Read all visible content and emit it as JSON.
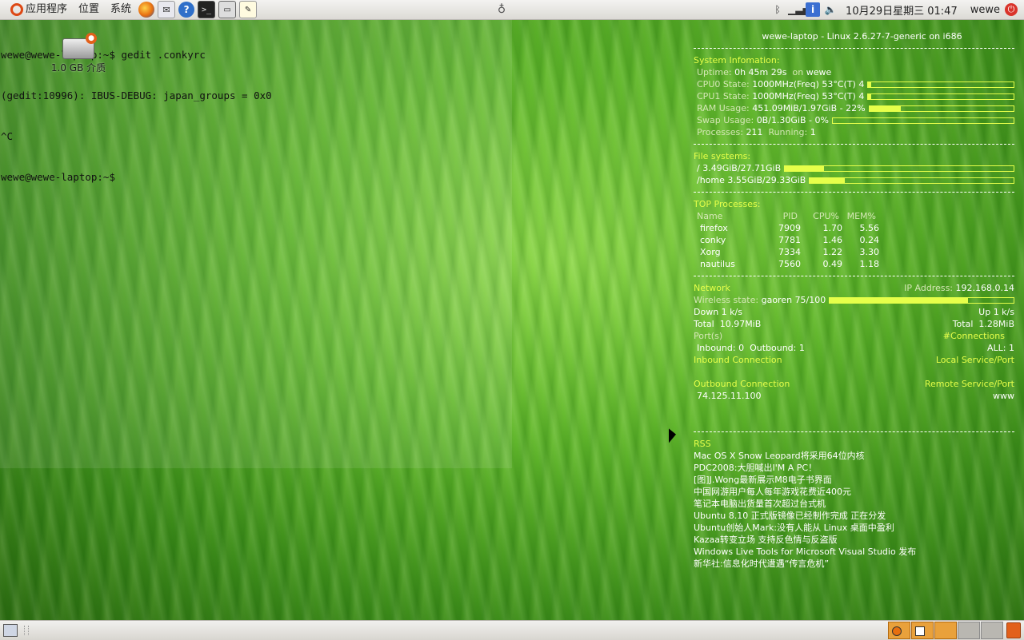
{
  "top_panel": {
    "menus": [
      "应用程序",
      "位置",
      "系统"
    ],
    "launchers": [
      "firefox-icon",
      "mail-icon",
      "help-icon",
      "terminal-icon",
      "screenshot-icon",
      "text-editor-icon"
    ],
    "clock": "10月29日星期三 01:47",
    "user": "wewe"
  },
  "terminal": {
    "lines": [
      "wewe@wewe-laptop:~$ gedit .conkyrc",
      "(gedit:10996): IBUS-DEBUG: japan_groups = 0x0",
      "^C",
      "wewe@wewe-laptop:~$"
    ]
  },
  "desktop": {
    "drive_label": "1.0 GB 介质"
  },
  "conky": {
    "title": "wewe-laptop - Linux 2.6.27-7-generic on i686",
    "system": {
      "heading": "System Infomation:",
      "uptime_label": "Uptime:",
      "uptime": "0h 45m 29s",
      "on_label": "on",
      "host_user": "wewe",
      "cpu0_label": "CPU0 State:",
      "cpu0_value": "1000MHz(Freq) 53°C(T) 4",
      "cpu0_pct": 0.02,
      "cpu1_label": "CPU1 State:",
      "cpu1_value": "1000MHz(Freq) 53°C(T) 4",
      "cpu1_pct": 0.02,
      "ram_label": "RAM Usage:",
      "ram_value": "451.09MiB/1.97GiB - 22%",
      "ram_pct": 0.22,
      "swap_label": "Swap Usage:",
      "swap_value": "0B/1.30GiB - 0%",
      "swap_pct": 0.0,
      "processes_label": "Processes:",
      "processes": "211",
      "running_label": "Running:",
      "running": "1"
    },
    "filesystems": {
      "heading": "File systems:",
      "root_label": "/",
      "root_value": "3.49GiB/27.71GiB",
      "root_pct": 0.17,
      "home_label": "/home",
      "home_value": "3.55GiB/29.33GiB",
      "home_pct": 0.17
    },
    "top": {
      "heading": "TOP Processes:",
      "columns": [
        "Name",
        "PID",
        "CPU%",
        "MEM%"
      ],
      "rows": [
        [
          "firefox",
          "7909",
          "1.70",
          "5.56"
        ],
        [
          "conky",
          "7781",
          "1.46",
          "0.24"
        ],
        [
          "Xorg",
          "7334",
          "1.22",
          "3.30"
        ],
        [
          "nautilus",
          "7560",
          "0.49",
          "1.18"
        ]
      ]
    },
    "network": {
      "heading": "Network",
      "ip_label": "IP Address:",
      "ip": "192.168.0.14",
      "wireless_label": "Wireless state:",
      "wireless_value": "gaoren 75/100",
      "wireless_pct": 0.75,
      "down_label": "Down",
      "down": "1 k/s",
      "up_label": "Up",
      "up": "1 k/s",
      "total_label": "Total",
      "total_down": "10.97MiB",
      "total_up": "1.28MiB",
      "ports_label": "Port(s)",
      "connections_label": "#Connections",
      "inbound_label": "Inbound:",
      "inbound": "0",
      "outbound_label": "Outbound:",
      "outbound": "1",
      "all_label": "ALL:",
      "all": "1",
      "inbound_conn_label": "Inbound Connection",
      "local_service_label": "Local Service/Port",
      "outbound_conn_label": "Outbound Connection",
      "remote_service_label": "Remote Service/Port",
      "remote_ip": "74.125.11.100",
      "remote_service": "www"
    },
    "rss": {
      "heading": "RSS",
      "items": [
        "Mac OS X Snow Leopard将采用64位内核",
        "PDC2008:大胆喊出I'M A PC！",
        "[图]J.Wong最新展示M8电子书界面",
        "中国网游用户每人每年游戏花费近400元",
        "笔记本电脑出货量首次超过台式机",
        "Ubuntu 8.10 正式版镜像已经制作完成 正在分发",
        "Ubuntu创始人Mark:没有人能从 Linux 桌面中盈利",
        "Kazaa转变立场 支持反色情与反盗版",
        "Windows Live Tools for Microsoft Visual Studio 发布",
        "新华社:信息化时代遭遇“传言危机”"
      ]
    }
  }
}
